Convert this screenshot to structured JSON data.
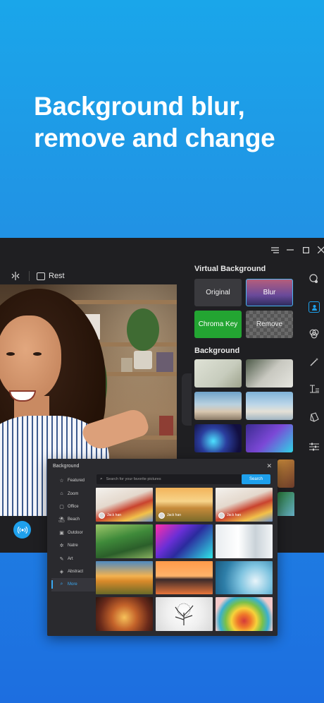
{
  "hero": {
    "line1": "Background blur,",
    "line2": "remove and change"
  },
  "window": {
    "controls": [
      "menu-icon",
      "minimize-icon",
      "maximize-icon",
      "close-icon"
    ]
  },
  "toolbar": {
    "rest_label": "Rest"
  },
  "virtual_background": {
    "title": "Virtual Background",
    "options": [
      {
        "label": "Original",
        "selected": false
      },
      {
        "label": "Blur",
        "selected": true
      },
      {
        "label": "Chroma Key",
        "selected": false
      },
      {
        "label": "Remove",
        "selected": false
      }
    ],
    "background_title": "Background"
  },
  "right_rail": {
    "icons": [
      "effects-icon",
      "portrait-icon",
      "filters-icon",
      "magic-wand-icon",
      "text-icon",
      "sticker-icon",
      "sliders-icon"
    ],
    "active": "portrait-icon"
  },
  "dialog": {
    "title": "Background",
    "categories": [
      {
        "label": "Featured",
        "icon": "featured-icon"
      },
      {
        "label": "Zoom",
        "icon": "zoom-icon"
      },
      {
        "label": "Office",
        "icon": "office-icon"
      },
      {
        "label": "Beach",
        "icon": "beach-icon"
      },
      {
        "label": "Outdoor",
        "icon": "outdoor-icon"
      },
      {
        "label": "Natre",
        "icon": "nature-icon"
      },
      {
        "label": "Art",
        "icon": "art-icon"
      },
      {
        "label": "Abstract",
        "icon": "abstract-icon"
      },
      {
        "label": "More",
        "icon": "more-icon"
      }
    ],
    "active_category": "More",
    "search": {
      "placeholder": "Search for your favorite pictures",
      "button": "Search"
    },
    "pictures": [
      {
        "author": "Jack han"
      },
      {
        "author": "Jack han"
      },
      {
        "author": "Jack han"
      }
    ]
  },
  "colors": {
    "accent": "#1ea0ec",
    "chroma_green": "#23a532",
    "window_bg": "#1f1f22"
  }
}
